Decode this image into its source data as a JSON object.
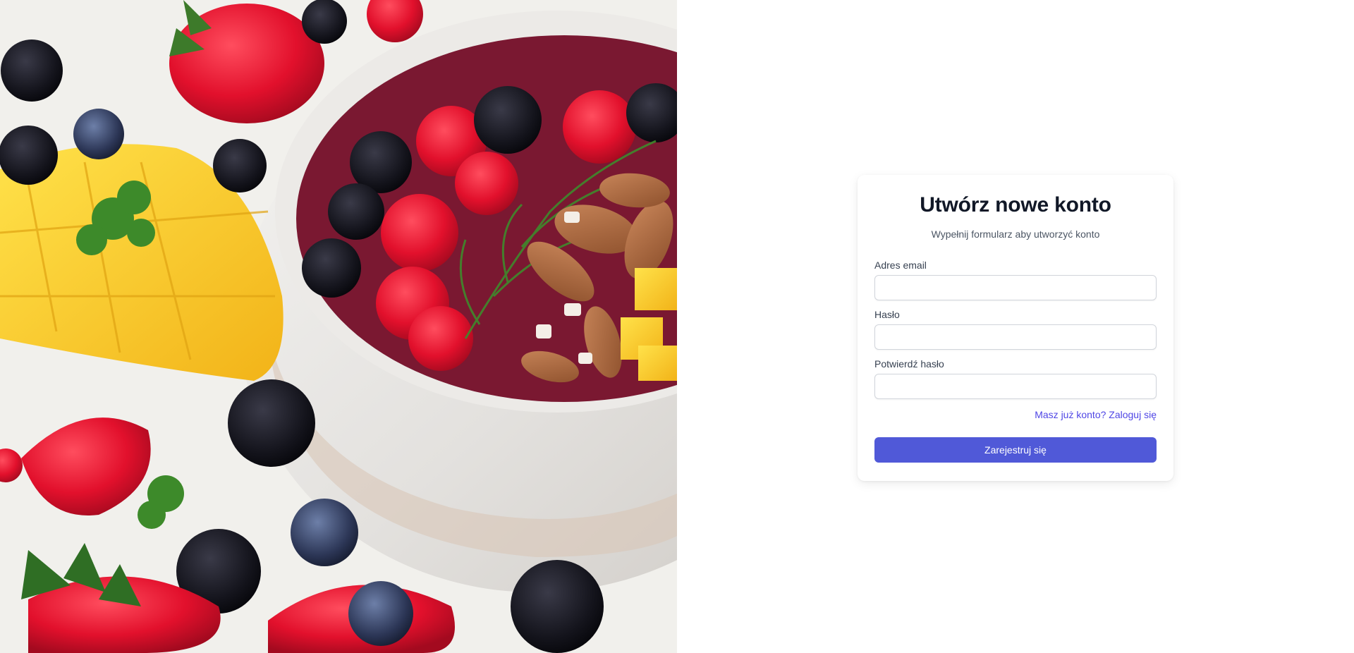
{
  "hero": {
    "image_subject": "fruit bowl with raspberries, blackberries, almonds, dill, mango, strawberries and blueberries"
  },
  "form": {
    "title": "Utwórz nowe konto",
    "subtitle": "Wypełnij formularz aby utworzyć konto",
    "email_label": "Adres email",
    "email_value": "",
    "password_label": "Hasło",
    "password_value": "",
    "confirm_label": "Potwierdź hasło",
    "confirm_value": "",
    "login_link": "Masz już konto? Zaloguj się",
    "submit_label": "Zarejestruj się"
  },
  "colors": {
    "accent": "#5059d8",
    "link": "#4f46e5",
    "title": "#111827"
  }
}
